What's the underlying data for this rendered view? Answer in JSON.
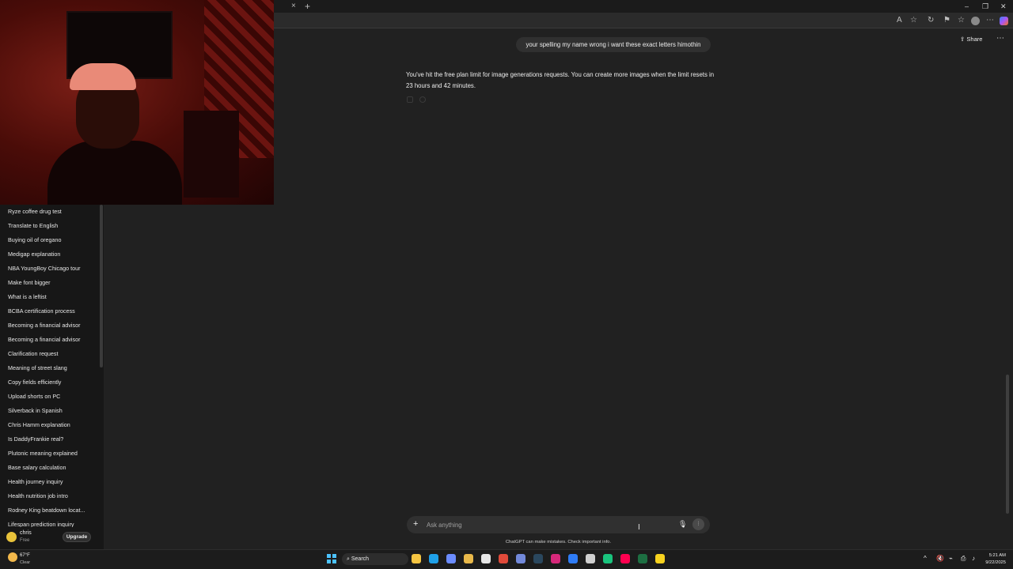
{
  "browser": {
    "tab_close": "×",
    "tab_new": "+",
    "window_controls": {
      "minimize": "–",
      "restore": "❐",
      "close": "✕"
    },
    "toolbar_icons": [
      "A",
      "☆",
      "↻",
      "⚑",
      "☆",
      "⋯"
    ]
  },
  "sidebar": {
    "chats": [
      "Ryze coffee drug test",
      "Translate to English",
      "Buying oil of oregano",
      "Medigap explanation",
      "NBA YoungBoy Chicago tour",
      "Make font bigger",
      "What is a leftist",
      "BCBA certification process",
      "Becoming a financial advisor",
      "Becoming a financial advisor",
      "Clarification request",
      "Meaning of street slang",
      "Copy fields efficiently",
      "Upload shorts on PC",
      "Silverback in Spanish",
      "Chris Hamm explanation",
      "Is DaddyFrankie real?",
      "Plutonic meaning explained",
      "Base salary calculation",
      "Health journey inquiry",
      "Health nutrition job intro",
      "Rodney King beatdown locat...",
      "Lifespan prediction inquiry"
    ],
    "user": {
      "name": "chris",
      "plan": "Free",
      "upgrade_label": "Upgrade"
    }
  },
  "header": {
    "share_label": "Share",
    "more_label": "⋯",
    "share_icon": "⇪"
  },
  "conversation": {
    "user_message": "your spelling my name wrong i want these exact letters himothin",
    "assistant_message": "You've hit the free plan limit for image generations requests. You can create more images when the limit resets in 23 hours and 42 minutes."
  },
  "composer": {
    "plus_label": "+",
    "placeholder": "Ask anything",
    "mic_label": "🎙",
    "voice_label": "⫶",
    "disclaimer": "ChatGPT can make mistakes. Check important info."
  },
  "taskbar": {
    "weather_temp": "67°F",
    "weather_condition": "Clear",
    "search_label": "Search",
    "search_icon": "⌕",
    "apps": [
      {
        "name": "file-explorer",
        "color": "#f5c542"
      },
      {
        "name": "edge",
        "color": "#1fa0e8"
      },
      {
        "name": "copilot",
        "color": "#6b8cff"
      },
      {
        "name": "folder",
        "color": "#e8b84a"
      },
      {
        "name": "store",
        "color": "#e6e6e6"
      },
      {
        "name": "chrome",
        "color": "#e04a3a"
      },
      {
        "name": "discord",
        "color": "#7289da"
      },
      {
        "name": "steam",
        "color": "#2a475e"
      },
      {
        "name": "instagram",
        "color": "#d6287a"
      },
      {
        "name": "messenger",
        "color": "#2f7cf6"
      },
      {
        "name": "chatgpt",
        "color": "#cfcfcf"
      },
      {
        "name": "capcut",
        "color": "#19c37d"
      },
      {
        "name": "tiktok",
        "color": "#ff0050"
      },
      {
        "name": "excel",
        "color": "#1d6f42"
      },
      {
        "name": "sticky-notes",
        "color": "#f7d21f"
      }
    ],
    "tray_icons": [
      "^",
      "🔇",
      "⌁",
      "⎙",
      "♪"
    ],
    "clock_time": "5:21 AM",
    "clock_date": "9/22/2025"
  }
}
